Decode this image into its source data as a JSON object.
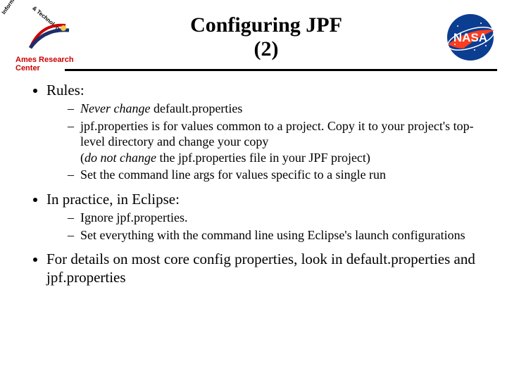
{
  "header": {
    "title_line1": "Configuring JPF",
    "title_line2": "(2)",
    "left_logo_center": "Ames Research Center",
    "left_logo_arc1": "Information Sciences",
    "left_logo_arc2": "& Technology",
    "nasa_text": "NASA"
  },
  "bullets": {
    "b1": "Rules:",
    "b1_sub": {
      "s1_it": "Never change",
      "s1_rest": " default.properties",
      "s2": "jpf.properties is for values common to a project.  Copy it to your project's top-level directory and change your copy",
      "s2b_open": "(",
      "s2b_it": "do not change",
      "s2b_rest": " the jpf.properties file in your JPF project)",
      "s3": "Set the command line args for values specific to a single run"
    },
    "b2": "In practice, in Eclipse:",
    "b2_sub": {
      "s1": "Ignore jpf.properties.",
      "s2": "Set everything with the command line using Eclipse's launch configurations"
    },
    "b3": "For details on most core config properties, look in default.properties and jpf.properties"
  }
}
